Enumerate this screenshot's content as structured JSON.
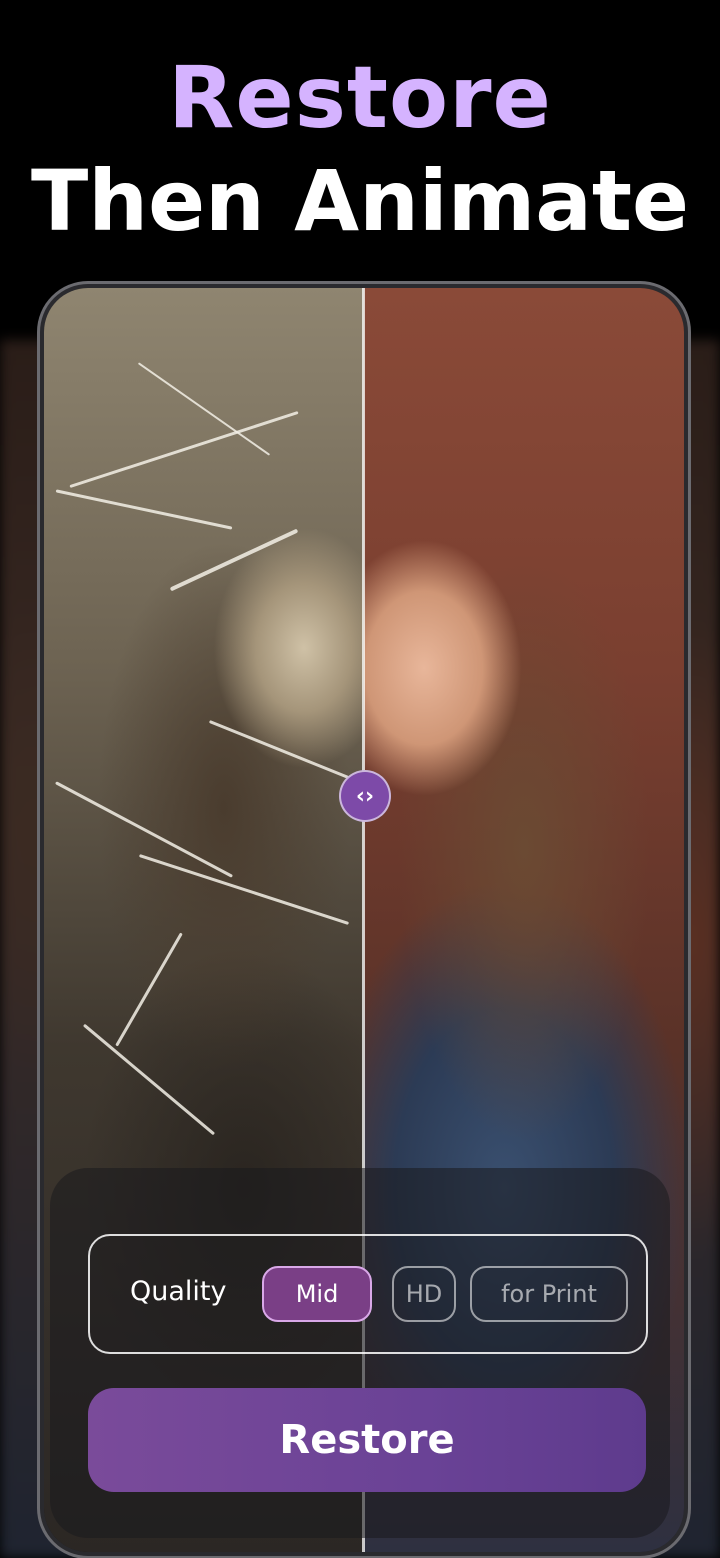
{
  "hero": {
    "line1": "Restore",
    "line2": "Then Animate"
  },
  "comparison": {
    "handle_icon": "chevrons-left-right-icon",
    "handle_glyph": "‹›"
  },
  "quality": {
    "label": "Quality",
    "options": [
      "Mid",
      "HD",
      "for Print"
    ],
    "selected": "Mid"
  },
  "actions": {
    "restore_label": "Restore"
  },
  "colors": {
    "accent_purple": "#d5b3ff",
    "button_purple": "#6a4296",
    "selected_option": "#7a3f86"
  }
}
